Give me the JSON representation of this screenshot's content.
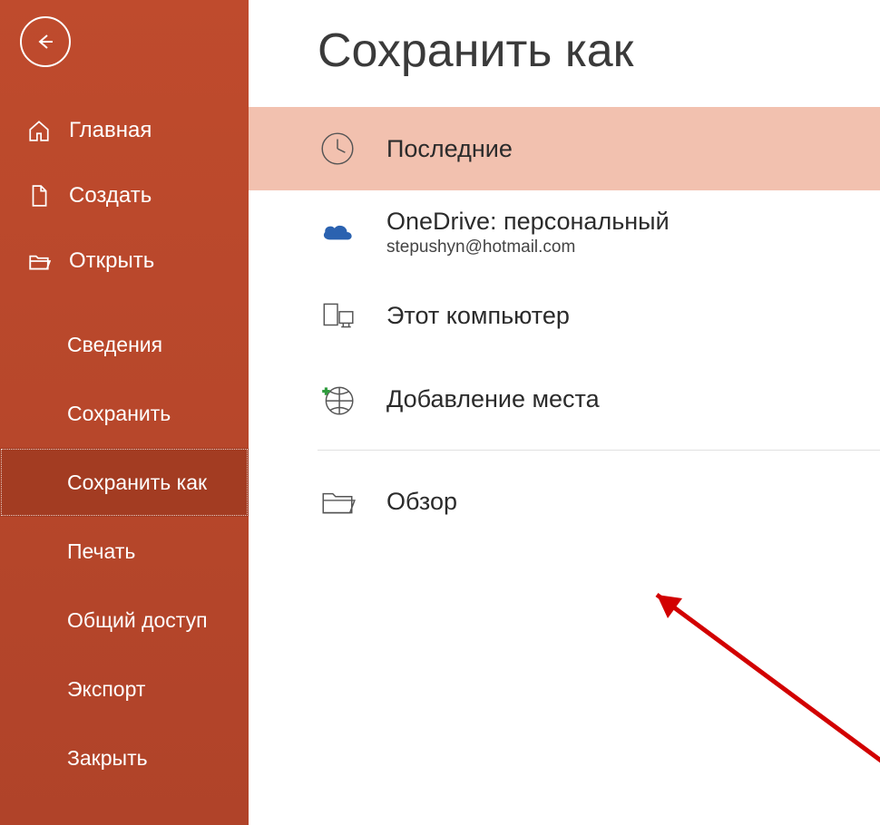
{
  "sidebar": {
    "items": [
      {
        "label": "Главная",
        "icon": "home-icon",
        "has_icon": true,
        "active": false
      },
      {
        "label": "Создать",
        "icon": "new-file-icon",
        "has_icon": true,
        "active": false
      },
      {
        "label": "Открыть",
        "icon": "folder-open-icon",
        "has_icon": true,
        "active": false
      },
      {
        "label": "Сведения",
        "icon": "",
        "has_icon": false,
        "active": false
      },
      {
        "label": "Сохранить",
        "icon": "",
        "has_icon": false,
        "active": false
      },
      {
        "label": "Сохранить как",
        "icon": "",
        "has_icon": false,
        "active": true
      },
      {
        "label": "Печать",
        "icon": "",
        "has_icon": false,
        "active": false
      },
      {
        "label": "Общий доступ",
        "icon": "",
        "has_icon": false,
        "active": false
      },
      {
        "label": "Экспорт",
        "icon": "",
        "has_icon": false,
        "active": false
      },
      {
        "label": "Закрыть",
        "icon": "",
        "has_icon": false,
        "active": false
      }
    ]
  },
  "page": {
    "title": "Сохранить как"
  },
  "options": [
    {
      "label": "Последние",
      "sublabel": "",
      "icon": "clock-icon",
      "selected": true
    },
    {
      "label": "OneDrive: персональный",
      "sublabel": "stepushyn@hotmail.com",
      "icon": "onedrive-icon",
      "selected": false
    },
    {
      "label": "Этот компьютер",
      "sublabel": "",
      "icon": "this-pc-icon",
      "selected": false
    },
    {
      "label": "Добавление места",
      "sublabel": "",
      "icon": "add-place-icon",
      "selected": false
    },
    {
      "label": "Обзор",
      "sublabel": "",
      "icon": "folder-open-icon",
      "selected": false
    }
  ]
}
